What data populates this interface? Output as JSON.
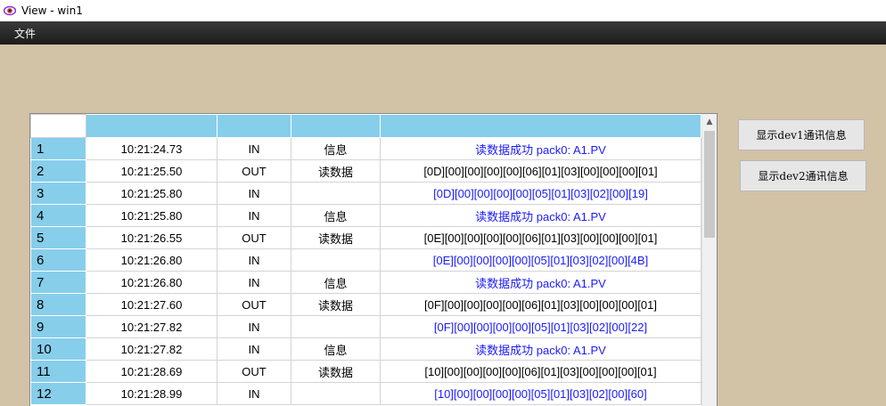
{
  "window": {
    "title": "View -   win1"
  },
  "menu": {
    "file_label": "文件"
  },
  "buttons": {
    "dev1": "显示dev1通讯信息",
    "dev2": "显示dev2通讯信息"
  },
  "table": {
    "headers": [
      "",
      "",
      "",
      "",
      ""
    ],
    "rows": [
      {
        "no": "1",
        "time": "10:21:24.73",
        "dir": "IN",
        "type": "信息",
        "msg": "读数据成功 pack0:  A1.PV",
        "color": "blue"
      },
      {
        "no": "2",
        "time": "10:21:25.50",
        "dir": "OUT",
        "type": "读数据",
        "msg": "[0D][00][00][00][00][06][01][03][00][00][00][01]",
        "color": "black"
      },
      {
        "no": "3",
        "time": "10:21:25.80",
        "dir": "IN",
        "type": "",
        "msg": "[0D][00][00][00][00][05][01][03][02][00][19]",
        "color": "blue"
      },
      {
        "no": "4",
        "time": "10:21:25.80",
        "dir": "IN",
        "type": "信息",
        "msg": "读数据成功 pack0:  A1.PV",
        "color": "blue"
      },
      {
        "no": "5",
        "time": "10:21:26.55",
        "dir": "OUT",
        "type": "读数据",
        "msg": "[0E][00][00][00][00][06][01][03][00][00][00][01]",
        "color": "black"
      },
      {
        "no": "6",
        "time": "10:21:26.80",
        "dir": "IN",
        "type": "",
        "msg": "[0E][00][00][00][00][05][01][03][02][00][4B]",
        "color": "blue"
      },
      {
        "no": "7",
        "time": "10:21:26.80",
        "dir": "IN",
        "type": "信息",
        "msg": "读数据成功 pack0:  A1.PV",
        "color": "blue"
      },
      {
        "no": "8",
        "time": "10:21:27.60",
        "dir": "OUT",
        "type": "读数据",
        "msg": "[0F][00][00][00][00][06][01][03][00][00][00][01]",
        "color": "black"
      },
      {
        "no": "9",
        "time": "10:21:27.82",
        "dir": "IN",
        "type": "",
        "msg": "[0F][00][00][00][00][05][01][03][02][00][22]",
        "color": "blue"
      },
      {
        "no": "10",
        "time": "10:21:27.82",
        "dir": "IN",
        "type": "信息",
        "msg": "读数据成功 pack0:  A1.PV",
        "color": "blue"
      },
      {
        "no": "11",
        "time": "10:21:28.69",
        "dir": "OUT",
        "type": "读数据",
        "msg": "[10][00][00][00][00][06][01][03][00][00][00][01]",
        "color": "black"
      },
      {
        "no": "12",
        "time": "10:21:28.99",
        "dir": "IN",
        "type": "",
        "msg": "[10][00][00][00][00][05][01][03][02][00][60]",
        "color": "blue"
      }
    ]
  },
  "colors": {
    "background": "#d2c2a6",
    "header": "#87ceeb",
    "in_message": "#1a1aff"
  },
  "icons": {
    "app": "eye-icon",
    "scroll_up": "scroll-up-arrow-icon"
  }
}
